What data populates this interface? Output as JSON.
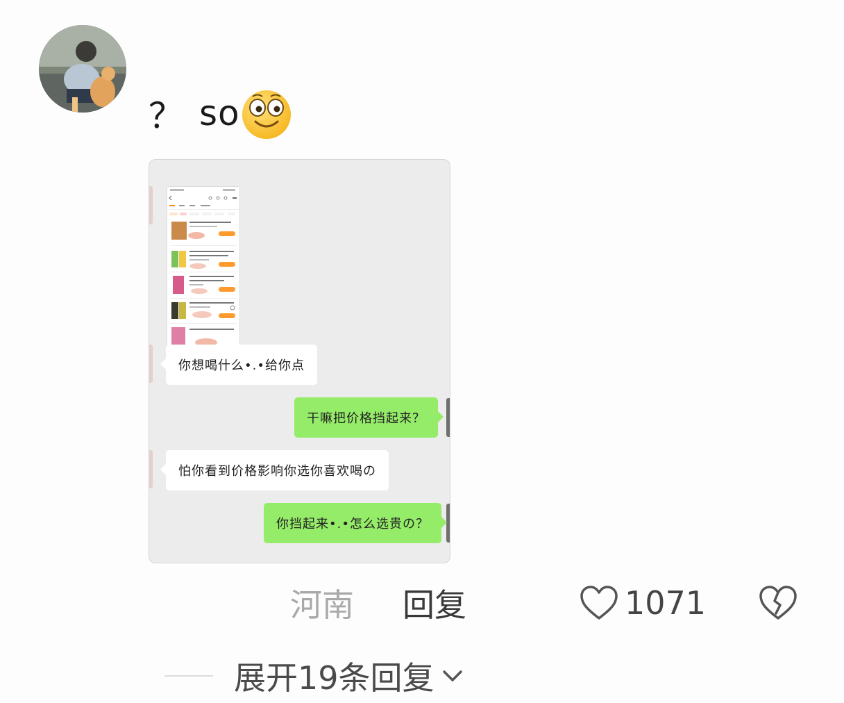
{
  "comment": {
    "prefix": "？",
    "text": "so",
    "emoji": "smiling-face-emoji"
  },
  "screenshot": {
    "messages": [
      {
        "side": "in",
        "text": "你想喝什么•.•给你点"
      },
      {
        "side": "out",
        "text": "干嘛把价格挡起来？"
      },
      {
        "side": "in",
        "text": "怕你看到价格影响你选你喜欢喝の"
      },
      {
        "side": "out",
        "text": "你挡起来•.•怎么选贵の？"
      }
    ],
    "bubble_colors": {
      "in": "#ffffff",
      "out": "#95ec69"
    }
  },
  "meta": {
    "location": "河南",
    "reply_label": "回复",
    "like_count": "1071",
    "like_icon": "heart-outline-icon",
    "dislike_icon": "broken-heart-icon"
  },
  "expand": {
    "label": "展开19条回复",
    "icon": "chevron-down-icon"
  }
}
